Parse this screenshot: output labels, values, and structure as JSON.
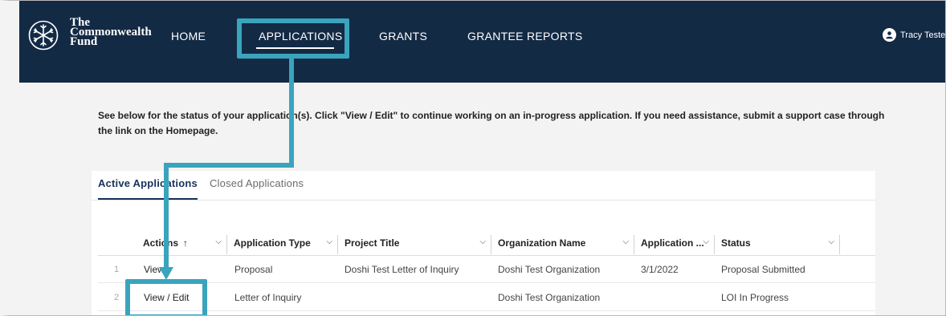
{
  "header": {
    "brand_lines": [
      "The",
      "Commonwealth",
      "Fund"
    ],
    "nav": [
      {
        "label": "HOME"
      },
      {
        "label": "APPLICATIONS",
        "active": true
      },
      {
        "label": "GRANTS"
      },
      {
        "label": "GRANTEE REPORTS"
      }
    ],
    "user_name": "Tracy Tester"
  },
  "intro_text": "See below for the status of your application(s). Click \"View / Edit\" to continue working on an in-progress application. If you need assistance, submit a support case through the link on the Homepage.",
  "tabs": [
    {
      "label": "Active Applications",
      "active": true
    },
    {
      "label": "Closed Applications",
      "active": false
    }
  ],
  "table": {
    "columns": [
      {
        "label": "Actions",
        "sort": "↑"
      },
      {
        "label": "Application Type"
      },
      {
        "label": "Project Title"
      },
      {
        "label": "Organization Name"
      },
      {
        "label": "Application ..."
      },
      {
        "label": "Status"
      }
    ],
    "rows": [
      {
        "num": "1",
        "action": "View",
        "type": "Proposal",
        "title": "Doshi Test Letter of Inquiry",
        "org": "Doshi Test Organization",
        "date": "3/1/2022",
        "status": "Proposal Submitted"
      },
      {
        "num": "2",
        "action": "View / Edit",
        "type": "Letter of Inquiry",
        "title": "",
        "org": "Doshi Test Organization",
        "date": "",
        "status": "LOI In Progress"
      }
    ]
  },
  "colors": {
    "header_bg": "#132a45",
    "highlight": "#3aa4bd",
    "active_tab": "#16325c"
  }
}
